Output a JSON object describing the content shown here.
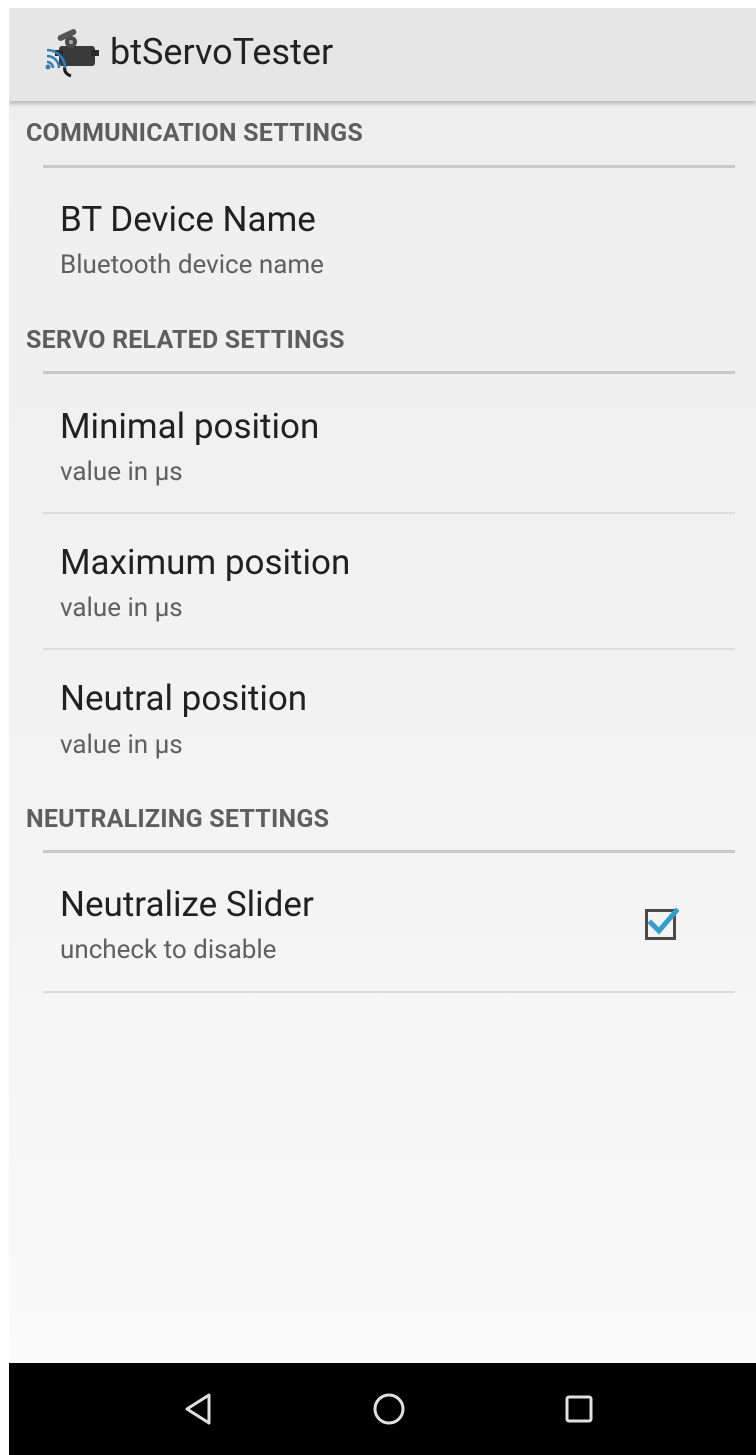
{
  "app": {
    "title": "btServoTester",
    "icon": "servo-bluetooth-app-icon"
  },
  "categories": {
    "communication": {
      "title": "COMMUNICATION SETTINGS",
      "items": [
        {
          "title": "BT Device Name",
          "summary": "Bluetooth device name"
        }
      ]
    },
    "servo": {
      "title": "SERVO RELATED SETTINGS",
      "items": [
        {
          "title": "Minimal position",
          "summary": "value in µs"
        },
        {
          "title": "Maximum position",
          "summary": "value in µs"
        },
        {
          "title": "Neutral position",
          "summary": "value in µs"
        }
      ]
    },
    "neutralizing": {
      "title": "NEUTRALIZING SETTINGS",
      "items": [
        {
          "title": "Neutralize Slider",
          "summary": "uncheck to disable",
          "checked": true
        }
      ]
    }
  },
  "navbar": {
    "buttons": [
      "back-icon",
      "home-icon",
      "recents-icon"
    ]
  },
  "colors": {
    "accent": "#2f9fd3",
    "appbar": "#e6e6e6",
    "navbar": "#000000"
  }
}
